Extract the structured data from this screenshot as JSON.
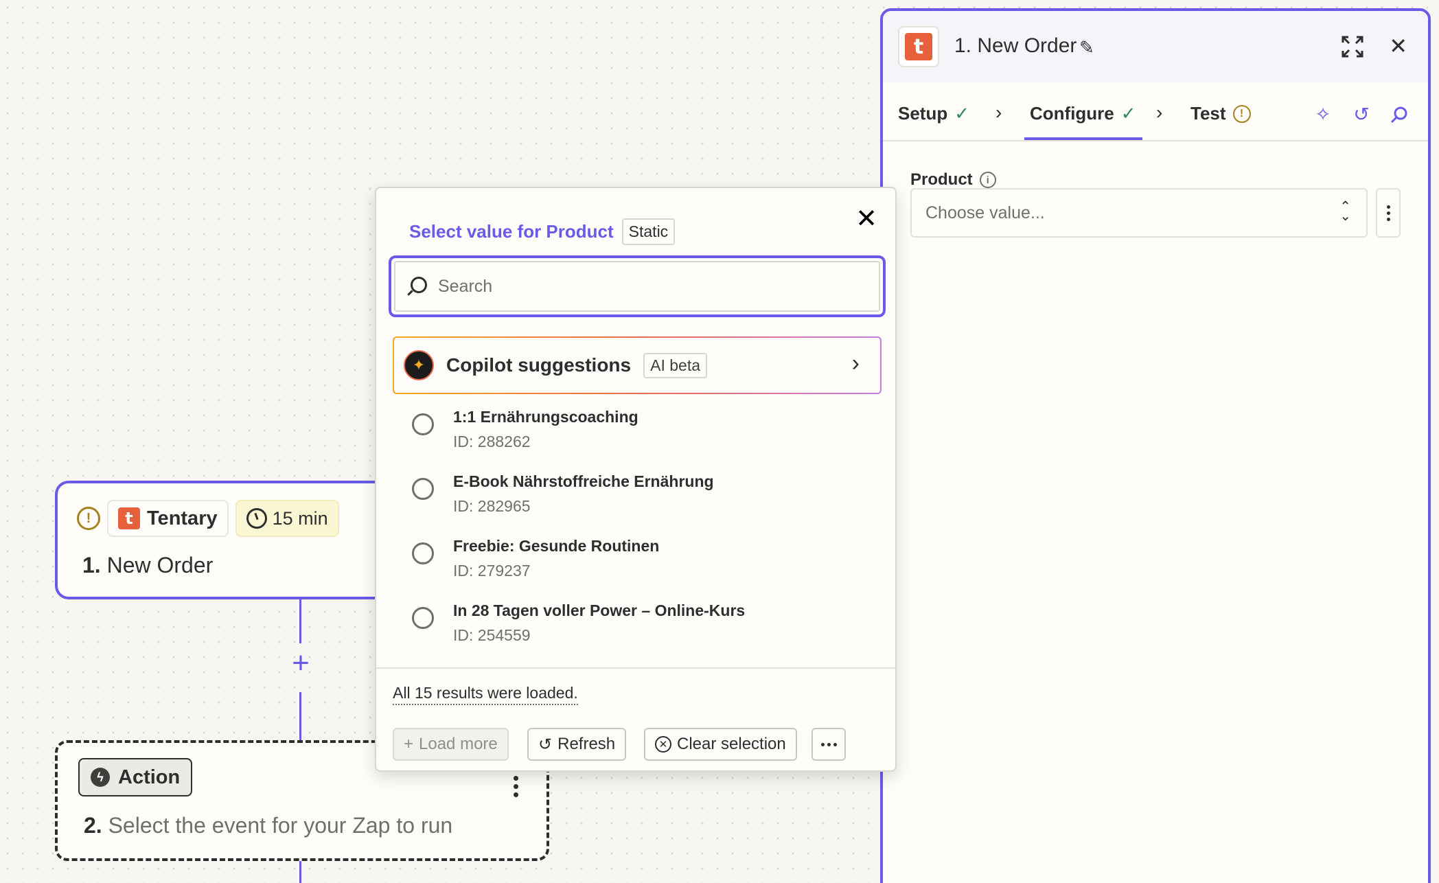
{
  "canvas": {
    "trigger": {
      "app_name": "Tentary",
      "app_logo_letter": "t",
      "interval": "15 min",
      "step_number": "1.",
      "title": "New Order"
    },
    "action": {
      "label": "Action",
      "step_number": "2.",
      "title": "Select the event for your Zap to run"
    }
  },
  "panel": {
    "logo_letter": "t",
    "title": "1. New Order",
    "tabs": [
      {
        "label": "Setup",
        "status": "complete"
      },
      {
        "label": "Configure",
        "status": "complete",
        "active": true
      },
      {
        "label": "Test",
        "status": "warning"
      }
    ],
    "field": {
      "label": "Product",
      "placeholder": "Choose value..."
    }
  },
  "popover": {
    "title": "Select value for Product",
    "badge": "Static",
    "search_placeholder": "Search",
    "copilot": {
      "label": "Copilot suggestions",
      "badge": "AI beta"
    },
    "options": [
      {
        "label": "1:1 Ernährungscoaching",
        "id": "ID: 288262"
      },
      {
        "label": "E-Book Nährstoffreiche Ernährung",
        "id": "ID: 282965"
      },
      {
        "label": "Freebie: Gesunde Routinen",
        "id": "ID: 279237"
      },
      {
        "label": "In 28 Tagen voller Power – Online-Kurs",
        "id": "ID: 254559"
      }
    ],
    "status": "All 15 results were loaded.",
    "buttons": {
      "load_more": "Load more",
      "refresh": "Refresh",
      "clear": "Clear selection"
    }
  },
  "colors": {
    "accent": "#695be8",
    "brand": "#e5603b",
    "warning": "#a5821d",
    "success": "#2e8b57",
    "canvas_bg": "#f7f6f2"
  }
}
